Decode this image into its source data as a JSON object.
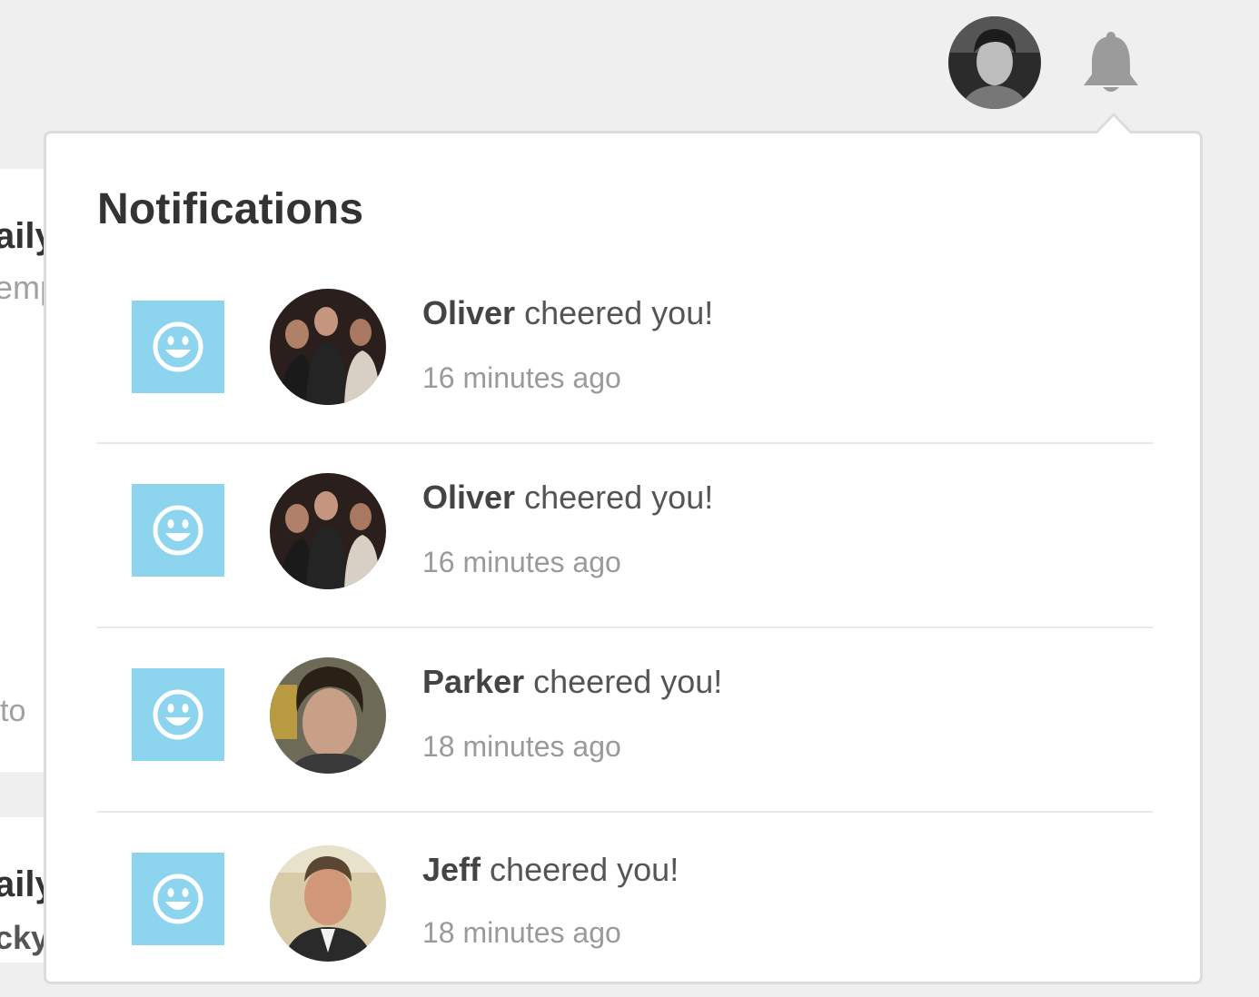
{
  "background": {
    "card1_title": "aily",
    "card1_sub": "emp",
    "card1_footer": "to",
    "card2_title": "aily",
    "card2_sub": "cky"
  },
  "header": {
    "avatar_icon": "user-avatar",
    "bell_icon": "bell-icon"
  },
  "notifications": {
    "title": "Notifications",
    "items": [
      {
        "name": "Oliver",
        "action": "cheered you!",
        "time": "16 minutes ago",
        "icon": "smiley-icon"
      },
      {
        "name": "Oliver",
        "action": "cheered you!",
        "time": "16 minutes ago",
        "icon": "smiley-icon"
      },
      {
        "name": "Parker",
        "action": "cheered you!",
        "time": "18 minutes ago",
        "icon": "smiley-icon"
      },
      {
        "name": "Jeff",
        "action": "cheered you!",
        "time": "18 minutes ago",
        "icon": "smiley-icon"
      }
    ]
  },
  "colors": {
    "page_bg": "#efefef",
    "tile": "#8dd4ef",
    "bell": "#9b9b9b",
    "title_text": "#333333"
  }
}
